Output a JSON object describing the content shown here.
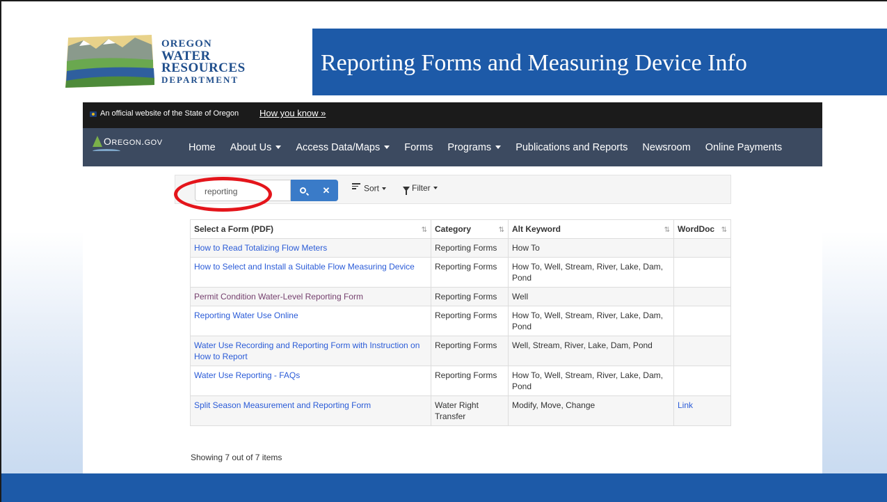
{
  "logo": {
    "line1": "OREGON",
    "line2": "WATER",
    "line3": "RESOURCES",
    "line4": "DEPARTMENT"
  },
  "slide_title": "Reporting Forms and Measuring Device Info",
  "official_bar": {
    "text": "An official website of the State of Oregon",
    "link": "How you know »"
  },
  "nav": {
    "brand": "Oregon.gov",
    "items": [
      {
        "label": "Home",
        "dropdown": false
      },
      {
        "label": "About Us",
        "dropdown": true
      },
      {
        "label": "Access Data/Maps",
        "dropdown": true
      },
      {
        "label": "Forms",
        "dropdown": false
      },
      {
        "label": "Programs",
        "dropdown": true
      },
      {
        "label": "Publications and Reports",
        "dropdown": false
      },
      {
        "label": "Newsroom",
        "dropdown": false
      },
      {
        "label": "Online Payments",
        "dropdown": false
      }
    ]
  },
  "toolbar": {
    "search_value": "reporting",
    "sort_label": "Sort",
    "filter_label": "Filter"
  },
  "table": {
    "headers": [
      "Select a Form (PDF)",
      "Category",
      "Alt Keyword",
      "WordDoc"
    ],
    "rows": [
      {
        "form": "How to Read Totalizing Flow Meters",
        "category": "Reporting Forms",
        "keyword": "How To",
        "worddoc": "",
        "visited": false
      },
      {
        "form": "How to Select and Install a Suitable Flow Measuring Device",
        "category": "Reporting Forms",
        "keyword": "How To, Well, Stream, River, Lake, Dam, Pond",
        "worddoc": "",
        "visited": false
      },
      {
        "form": "Permit Condition Water-Level Reporting Form",
        "category": "Reporting Forms",
        "keyword": "Well",
        "worddoc": "",
        "visited": true
      },
      {
        "form": "Reporting Water Use Online",
        "category": "Reporting Forms",
        "keyword": "How To, Well, Stream, River, Lake, Dam, Pond",
        "worddoc": "",
        "visited": false
      },
      {
        "form": "Water Use Recording and Reporting Form with Instruction on How to Report",
        "category": "Reporting Forms",
        "keyword": "Well, Stream, River, Lake, Dam, Pond",
        "worddoc": "",
        "visited": false
      },
      {
        "form": "Water Use Reporting - FAQs",
        "category": "Reporting Forms",
        "keyword": "How To, Well, Stream, River, Lake, Dam, Pond",
        "worddoc": "",
        "visited": false
      },
      {
        "form": "Split Season Measurement and Reporting Form",
        "category": "Water Right Transfer",
        "keyword": "Modify, Move, Change",
        "worddoc": "Link",
        "visited": false
      }
    ]
  },
  "count_text": "Showing 7 out of 7 items",
  "colors": {
    "title_banner": "#1d5aa8",
    "nav": "#3c4a60",
    "highlight_circle": "#e4151b",
    "link": "#2a5bd7"
  }
}
